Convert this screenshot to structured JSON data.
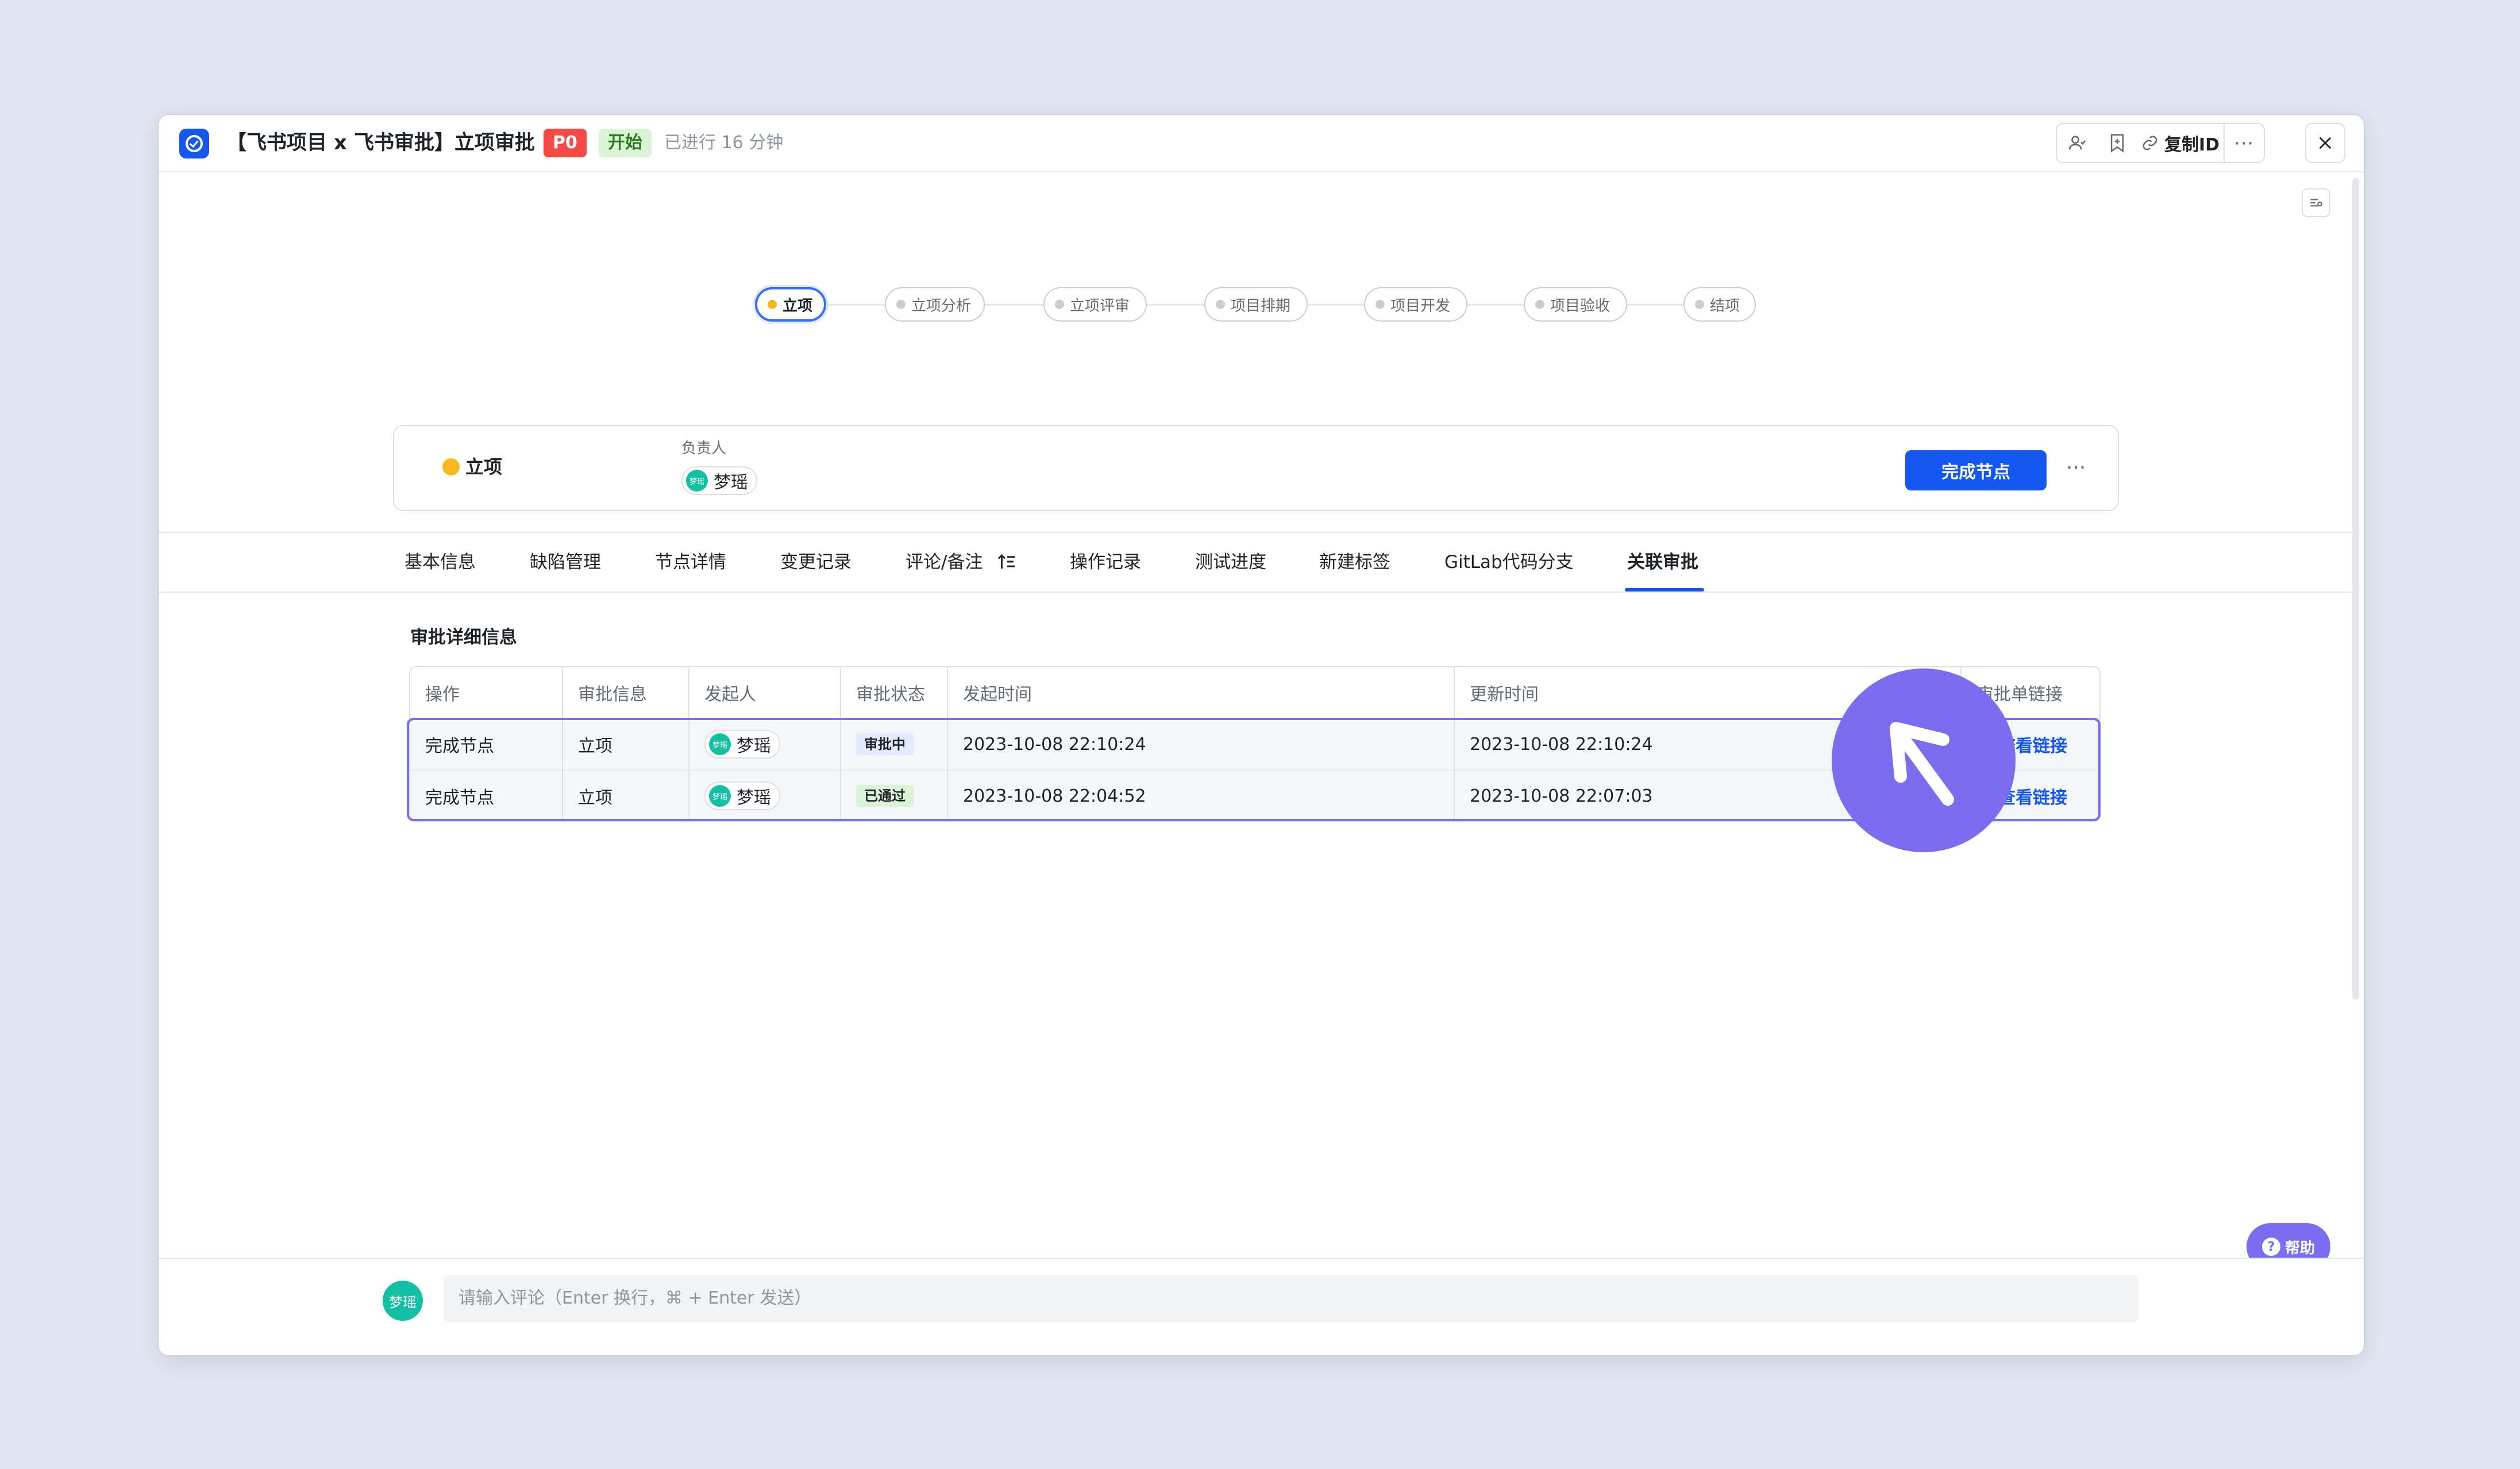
{
  "window": {
    "title": "【飞书项目 x 飞书审批】立项审批",
    "priority_badge": "P0",
    "status_badge": "开始",
    "elapsed": "已进行 16 分钟",
    "copy_id_label": "复制ID"
  },
  "workflow": {
    "nodes": [
      {
        "label": "立项",
        "active": true
      },
      {
        "label": "立项分析",
        "active": false
      },
      {
        "label": "立项评审",
        "active": false
      },
      {
        "label": "项目排期",
        "active": false
      },
      {
        "label": "项目开发",
        "active": false
      },
      {
        "label": "项目验收",
        "active": false
      },
      {
        "label": "结项",
        "active": false
      }
    ]
  },
  "node_card": {
    "name": "立项",
    "owner_label": "负责人",
    "owner": {
      "name": "梦瑶",
      "avatar_text": "梦瑶"
    },
    "complete_button": "完成节点",
    "more": "···"
  },
  "tabs": [
    "基本信息",
    "缺陷管理",
    "节点详情",
    "变更记录",
    "评论/备注",
    "操作记录",
    "测试进度",
    "新建标签",
    "GitLab代码分支",
    "关联审批"
  ],
  "active_tab": "关联审批",
  "section_title": "审批详细信息",
  "table": {
    "headers": [
      "操作",
      "审批信息",
      "发起人",
      "审批状态",
      "发起时间",
      "更新时间",
      "审批单链接"
    ],
    "rows": [
      {
        "action": "完成节点",
        "info": "立项",
        "initiator": "梦瑶",
        "status": "审批中",
        "start": "2023-10-08 22:10:24",
        "update": "2023-10-08 22:10:24",
        "link": "查看链接"
      },
      {
        "action": "完成节点",
        "info": "立项",
        "initiator": "梦瑶",
        "status": "已通过",
        "start": "2023-10-08 22:04:52",
        "update": "2023-10-08 22:07:03",
        "link": "查看链接"
      }
    ]
  },
  "help_label": "帮助",
  "comment": {
    "avatar_text": "梦瑶",
    "placeholder": "请输入评论（Enter 换行，⌘ + Enter 发送）"
  },
  "colors": {
    "accent": "#1456f0",
    "cursor": "#7b6cf0",
    "priority_red": "#f54a45",
    "pending_dot": "#f7ba1e"
  }
}
